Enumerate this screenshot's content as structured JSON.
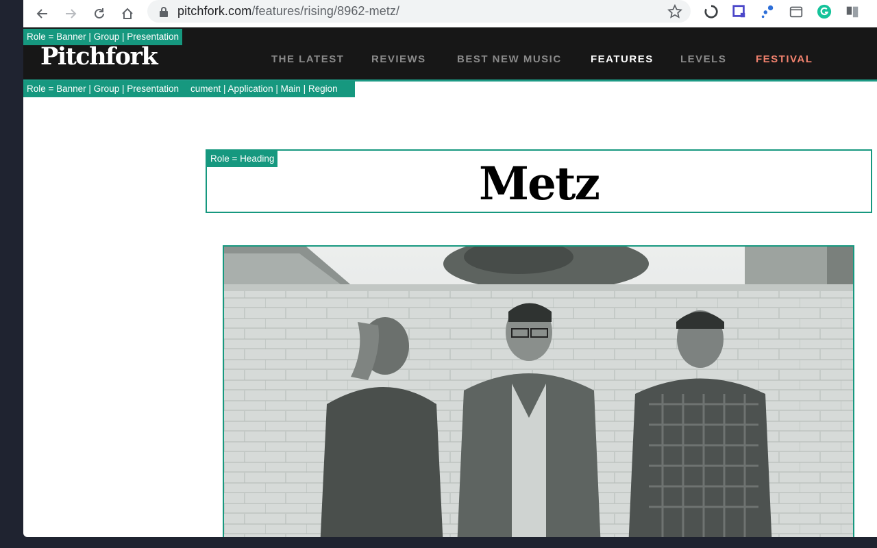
{
  "browser": {
    "url_host": "pitchfork.com",
    "url_path": "/features/rising/8962-metz/",
    "icons": [
      "back-arrow-icon",
      "forward-arrow-icon",
      "reload-icon",
      "home-icon",
      "lock-icon",
      "star-icon"
    ],
    "extensions": [
      "extension-1-icon",
      "extension-2-icon",
      "extension-3-icon",
      "extension-4-icon",
      "grammarly-icon",
      "extension-6-icon"
    ]
  },
  "site": {
    "logo": "Pitchfork",
    "nav": [
      {
        "label": "THE LATEST"
      },
      {
        "label": "REVIEWS"
      },
      {
        "label": "BEST NEW MUSIC"
      },
      {
        "label": "FEATURES"
      },
      {
        "label": "LEVELS"
      },
      {
        "label": "FESTIVAL"
      }
    ]
  },
  "overlays": {
    "banner_role": "Role = Banner | Group | Presentation",
    "main_role": "Role = Banner | Group | Presentation",
    "main_role_overlap": "cument | Application | Main | Region",
    "heading_role": "Role = Heading"
  },
  "article": {
    "title": "Metz"
  },
  "colors": {
    "accent": "#16987f",
    "header_bg": "#171717",
    "festival": "#f2826e"
  }
}
